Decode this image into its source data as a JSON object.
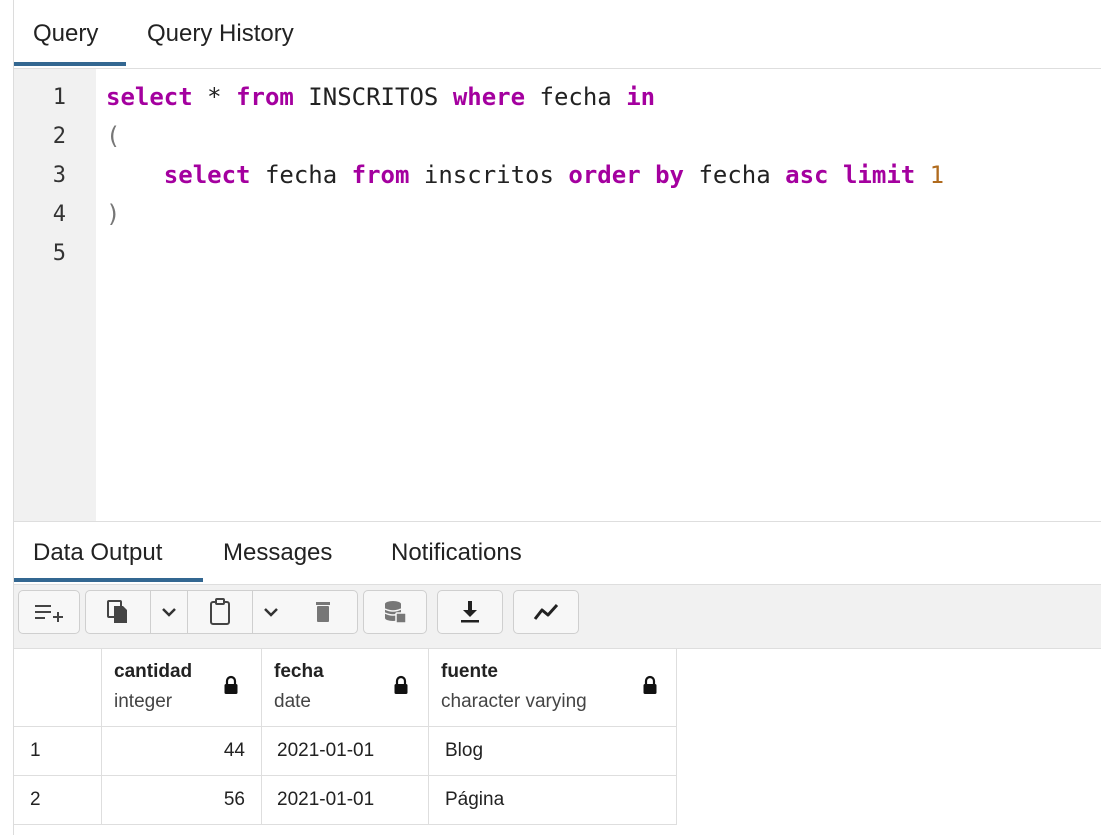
{
  "query_tabs": [
    "Query",
    "Query History"
  ],
  "editor": {
    "line_numbers": [
      "1",
      "2",
      "3",
      "4",
      "5"
    ],
    "lines": [
      [
        {
          "t": "select",
          "c": "kw"
        },
        {
          "t": " * ",
          "c": ""
        },
        {
          "t": "from",
          "c": "kw"
        },
        {
          "t": " INSCRITOS ",
          "c": ""
        },
        {
          "t": "where",
          "c": "kw"
        },
        {
          "t": " fecha ",
          "c": ""
        },
        {
          "t": "in",
          "c": "kw"
        }
      ],
      [
        {
          "t": "(",
          "c": "paren"
        }
      ],
      [
        {
          "t": "    ",
          "c": ""
        },
        {
          "t": "select",
          "c": "kw"
        },
        {
          "t": " fecha ",
          "c": ""
        },
        {
          "t": "from",
          "c": "kw"
        },
        {
          "t": " inscritos ",
          "c": ""
        },
        {
          "t": "order by",
          "c": "kw"
        },
        {
          "t": " fecha ",
          "c": ""
        },
        {
          "t": "asc",
          "c": "kw"
        },
        {
          "t": " ",
          "c": ""
        },
        {
          "t": "limit",
          "c": "kw"
        },
        {
          "t": " ",
          "c": ""
        },
        {
          "t": "1",
          "c": "num"
        }
      ],
      [
        {
          "t": ")",
          "c": "paren"
        }
      ],
      []
    ]
  },
  "output_tabs": [
    "Data Output",
    "Messages",
    "Notifications"
  ],
  "toolbar": {
    "icons": [
      "add-row-icon",
      "copy-icon",
      "chevron-down-icon",
      "paste-icon",
      "chevron-down-icon",
      "delete-icon",
      "save-data-icon",
      "download-icon",
      "graph-icon"
    ]
  },
  "grid": {
    "columns": [
      {
        "name": "cantidad",
        "type": "integer"
      },
      {
        "name": "fecha",
        "type": "date"
      },
      {
        "name": "fuente",
        "type": "character varying"
      }
    ],
    "rows": [
      {
        "n": "1",
        "cells": [
          "44",
          "2021-01-01",
          "Blog"
        ]
      },
      {
        "n": "2",
        "cells": [
          "56",
          "2021-01-01",
          "Página"
        ]
      }
    ]
  },
  "colors": {
    "accent": "#336791",
    "keyword": "#a4009f",
    "number": "#b06b1e"
  }
}
